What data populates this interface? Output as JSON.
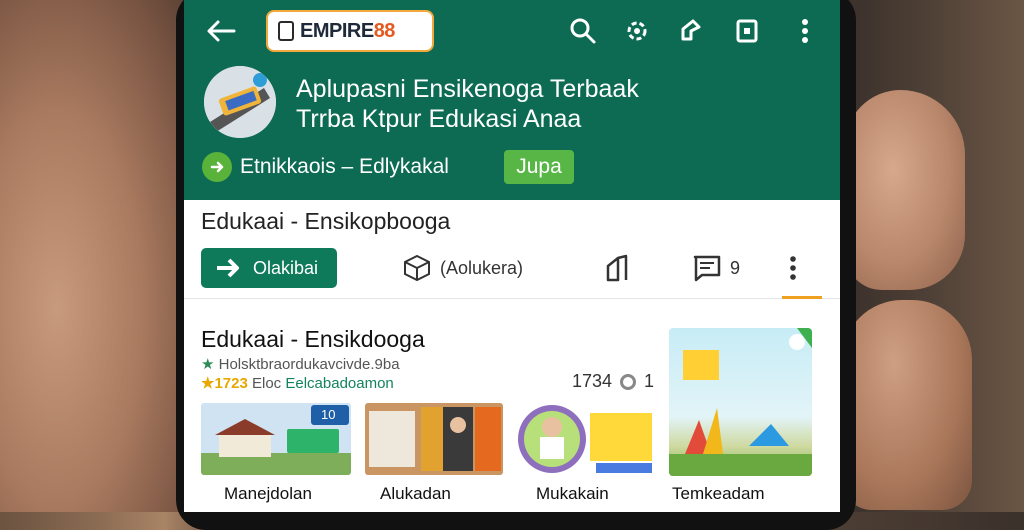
{
  "header": {
    "logo": {
      "text_main": "EMPIRE",
      "text_accent": "88"
    },
    "app_title_lines": [
      "Aplupasni Ensikenoga Terbaak",
      "Trrba Ktpur Edukasi Anaa"
    ],
    "developer": "Etnikkaois – Edlykakal",
    "join_label": "Jupa",
    "icons": [
      "back-arrow-icon",
      "search-icon",
      "settings-gear-icon",
      "share-icon",
      "bookmark-icon",
      "more-vert-icon"
    ]
  },
  "toolbar": {
    "section_title": "Edukaai - Ensikopbooga",
    "install_label": "Olakibai",
    "category_label": "(Aolukera)",
    "comments_count": "9"
  },
  "content": {
    "title": "Edukaai - Ensikdooga",
    "subtitle": "Holsktbraordukavcivde.9ba",
    "rating_stars": "1723",
    "rating_text": "Eloc",
    "rating_label": "Eelcabadoamon",
    "downloads": "1734",
    "downloads_extra": "1",
    "cards": [
      {
        "label": "Manejdolan",
        "badge": "10"
      },
      {
        "label": "Alukadan"
      },
      {
        "label": "Mukakain"
      },
      {
        "label": "Temkeadam"
      }
    ]
  },
  "colors": {
    "header_green": "#0d6b53",
    "button_green": "#0f7a5a",
    "join_green": "#57b646",
    "accent_orange": "#f0a020"
  }
}
